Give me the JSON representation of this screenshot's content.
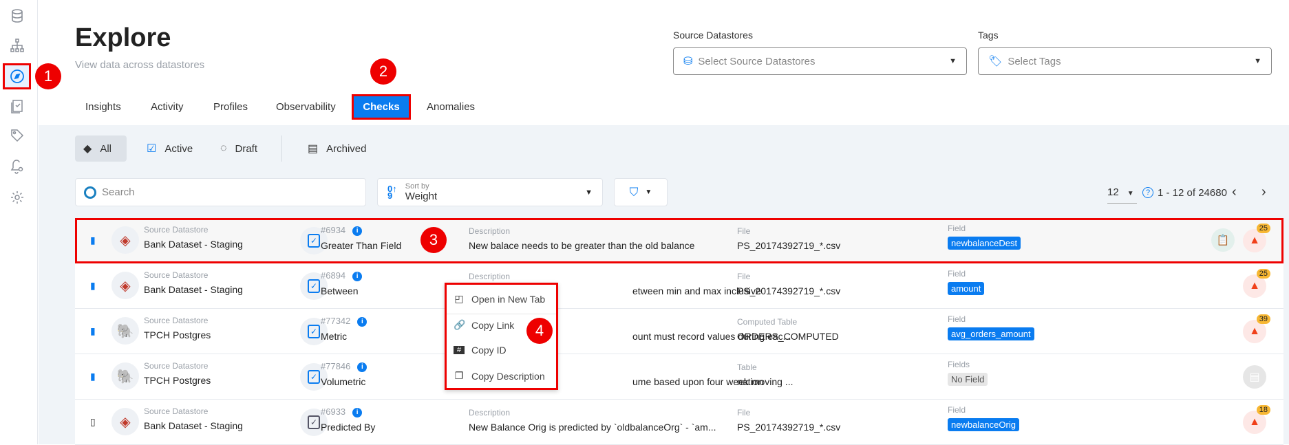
{
  "sidebar": {
    "items": [
      {
        "icon": "database-icon"
      },
      {
        "icon": "hierarchy-icon"
      },
      {
        "icon": "compass-icon",
        "active": true
      },
      {
        "icon": "clipboard-check-icon"
      },
      {
        "icon": "tag-icon"
      },
      {
        "icon": "bell-settings-icon"
      },
      {
        "icon": "gear-icon"
      }
    ]
  },
  "header": {
    "title": "Explore",
    "subtitle": "View data across datastores"
  },
  "filters": {
    "source_label": "Source Datastores",
    "source_placeholder": "Select Source Datastores",
    "tags_label": "Tags",
    "tags_placeholder": "Select Tags"
  },
  "tabs": [
    "Insights",
    "Activity",
    "Profiles",
    "Observability",
    "Checks",
    "Anomalies"
  ],
  "active_tab": "Checks",
  "status_tabs": [
    "All",
    "Active",
    "Draft",
    "Archived"
  ],
  "toolbar": {
    "search_placeholder": "Search",
    "sort_label": "Sort by",
    "sort_value": "Weight",
    "page_size": "12",
    "range": "1 - 12 of 24680"
  },
  "annotations": [
    "1",
    "2",
    "3",
    "4"
  ],
  "rows": [
    {
      "source_label": "Source Datastore",
      "source": "Bank Dataset - Staging",
      "id": "#6934",
      "check": "Greater Than Field",
      "desc_label": "Description",
      "desc": "New balace needs to be greater than the old balance",
      "loc_label": "File",
      "loc": "PS_20174392719_*.csv",
      "field_label": "Field",
      "field": "newbalanceDest",
      "count": "25",
      "bookmarked": true
    },
    {
      "source_label": "Source Datastore",
      "source": "Bank Dataset - Staging",
      "id": "#6894",
      "check": "Between",
      "desc_label": "Description",
      "desc": "etween min and max inclusive",
      "loc_label": "File",
      "loc": "PS_20174392719_*.csv",
      "field_label": "Field",
      "field": "amount",
      "count": "25",
      "bookmarked": true
    },
    {
      "source_label": "Source Datastore",
      "source": "TPCH Postgres",
      "id": "#77342",
      "check": "Metric",
      "desc_label": "",
      "desc": "ount must record values during eac...",
      "loc_label": "Computed Table",
      "loc": "ORDERS_COMPUTED",
      "field_label": "Field",
      "field": "avg_orders_amount",
      "count": "39",
      "bookmarked": true
    },
    {
      "source_label": "Source Datastore",
      "source": "TPCH Postgres",
      "id": "#77846",
      "check": "Volumetric",
      "desc_label": "",
      "desc": "ume based upon four week moving ...",
      "loc_label": "Table",
      "loc": "nation",
      "field_label": "Fields",
      "field": "No Field",
      "count": "",
      "bookmarked": true
    },
    {
      "source_label": "Source Datastore",
      "source": "Bank Dataset - Staging",
      "id": "#6933",
      "check": "Predicted By",
      "desc_label": "Description",
      "desc": "New Balance Orig is predicted by `oldbalanceOrg` - `am...",
      "loc_label": "File",
      "loc": "PS_20174392719_*.csv",
      "field_label": "Field",
      "field": "newbalanceOrig",
      "count": "18",
      "bookmarked": false
    }
  ],
  "context_menu": [
    "Open in New Tab",
    "Copy Link",
    "Copy ID",
    "Copy Description"
  ],
  "colors": {
    "accent": "#0a7cf0",
    "annotation": "#e00000",
    "count_badge": "#f7b733",
    "alert": "#f0401a"
  }
}
